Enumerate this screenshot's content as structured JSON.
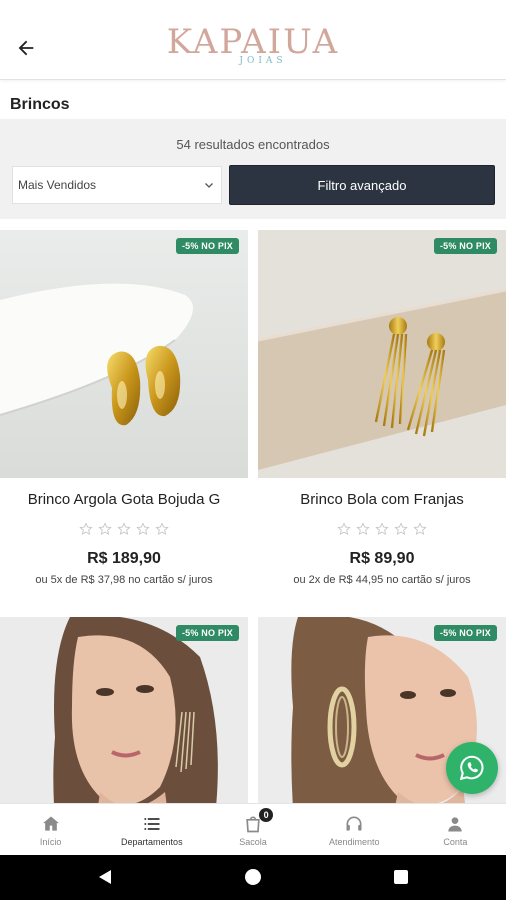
{
  "header": {
    "logo_main": "KAPAIUA",
    "logo_sub": "JOIAS"
  },
  "page": {
    "title": "Brincos"
  },
  "filter": {
    "results": "54 resultados encontrados",
    "sort_value": "Mais Vendidos",
    "advanced_filter_label": "Filtro avançado"
  },
  "products": [
    {
      "badge": "-5% NO PIX",
      "name": "Brinco Argola Gota Bojuda G",
      "rating": 0,
      "price": "R$ 189,90",
      "installments": "ou 5x de R$ 37,98 no cartão s/ juros"
    },
    {
      "badge": "-5% NO PIX",
      "name": "Brinco Bola com Franjas",
      "rating": 0,
      "price": "R$ 89,90",
      "installments": "ou 2x de R$ 44,95 no cartão s/ juros"
    },
    {
      "badge": "-5% NO PIX"
    },
    {
      "badge": "-5% NO PIX"
    }
  ],
  "tabbar": {
    "items": [
      {
        "label": "Início",
        "icon": "home-icon"
      },
      {
        "label": "Departamentos",
        "icon": "list-icon"
      },
      {
        "label": "Sacola",
        "icon": "bag-icon",
        "count": "0"
      },
      {
        "label": "Atendimento",
        "icon": "headset-icon"
      },
      {
        "label": "Conta",
        "icon": "user-icon"
      }
    ]
  },
  "colors": {
    "badge": "#2f8b63",
    "filter_button": "#2b3440",
    "whatsapp": "#2fb36b",
    "logo": "#d2a79b"
  }
}
